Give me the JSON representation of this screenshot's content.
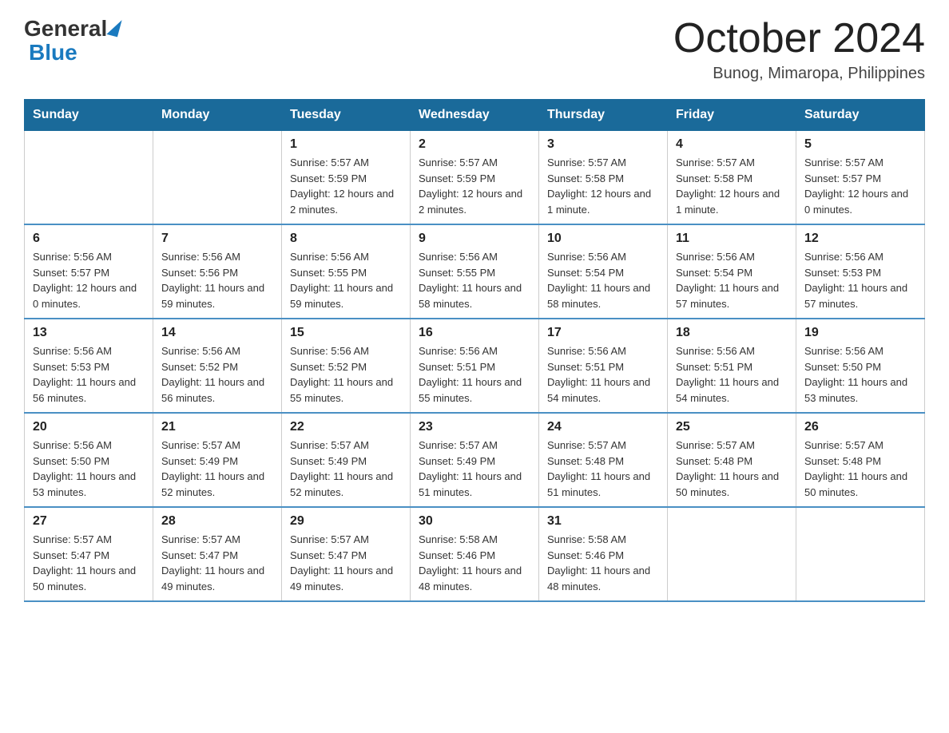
{
  "header": {
    "logo_general": "General",
    "logo_blue": "Blue",
    "month_title": "October 2024",
    "location": "Bunog, Mimaropa, Philippines"
  },
  "days_of_week": [
    "Sunday",
    "Monday",
    "Tuesday",
    "Wednesday",
    "Thursday",
    "Friday",
    "Saturday"
  ],
  "weeks": [
    [
      {
        "day": "",
        "sunrise": "",
        "sunset": "",
        "daylight": ""
      },
      {
        "day": "",
        "sunrise": "",
        "sunset": "",
        "daylight": ""
      },
      {
        "day": "1",
        "sunrise": "Sunrise: 5:57 AM",
        "sunset": "Sunset: 5:59 PM",
        "daylight": "Daylight: 12 hours and 2 minutes."
      },
      {
        "day": "2",
        "sunrise": "Sunrise: 5:57 AM",
        "sunset": "Sunset: 5:59 PM",
        "daylight": "Daylight: 12 hours and 2 minutes."
      },
      {
        "day": "3",
        "sunrise": "Sunrise: 5:57 AM",
        "sunset": "Sunset: 5:58 PM",
        "daylight": "Daylight: 12 hours and 1 minute."
      },
      {
        "day": "4",
        "sunrise": "Sunrise: 5:57 AM",
        "sunset": "Sunset: 5:58 PM",
        "daylight": "Daylight: 12 hours and 1 minute."
      },
      {
        "day": "5",
        "sunrise": "Sunrise: 5:57 AM",
        "sunset": "Sunset: 5:57 PM",
        "daylight": "Daylight: 12 hours and 0 minutes."
      }
    ],
    [
      {
        "day": "6",
        "sunrise": "Sunrise: 5:56 AM",
        "sunset": "Sunset: 5:57 PM",
        "daylight": "Daylight: 12 hours and 0 minutes."
      },
      {
        "day": "7",
        "sunrise": "Sunrise: 5:56 AM",
        "sunset": "Sunset: 5:56 PM",
        "daylight": "Daylight: 11 hours and 59 minutes."
      },
      {
        "day": "8",
        "sunrise": "Sunrise: 5:56 AM",
        "sunset": "Sunset: 5:55 PM",
        "daylight": "Daylight: 11 hours and 59 minutes."
      },
      {
        "day": "9",
        "sunrise": "Sunrise: 5:56 AM",
        "sunset": "Sunset: 5:55 PM",
        "daylight": "Daylight: 11 hours and 58 minutes."
      },
      {
        "day": "10",
        "sunrise": "Sunrise: 5:56 AM",
        "sunset": "Sunset: 5:54 PM",
        "daylight": "Daylight: 11 hours and 58 minutes."
      },
      {
        "day": "11",
        "sunrise": "Sunrise: 5:56 AM",
        "sunset": "Sunset: 5:54 PM",
        "daylight": "Daylight: 11 hours and 57 minutes."
      },
      {
        "day": "12",
        "sunrise": "Sunrise: 5:56 AM",
        "sunset": "Sunset: 5:53 PM",
        "daylight": "Daylight: 11 hours and 57 minutes."
      }
    ],
    [
      {
        "day": "13",
        "sunrise": "Sunrise: 5:56 AM",
        "sunset": "Sunset: 5:53 PM",
        "daylight": "Daylight: 11 hours and 56 minutes."
      },
      {
        "day": "14",
        "sunrise": "Sunrise: 5:56 AM",
        "sunset": "Sunset: 5:52 PM",
        "daylight": "Daylight: 11 hours and 56 minutes."
      },
      {
        "day": "15",
        "sunrise": "Sunrise: 5:56 AM",
        "sunset": "Sunset: 5:52 PM",
        "daylight": "Daylight: 11 hours and 55 minutes."
      },
      {
        "day": "16",
        "sunrise": "Sunrise: 5:56 AM",
        "sunset": "Sunset: 5:51 PM",
        "daylight": "Daylight: 11 hours and 55 minutes."
      },
      {
        "day": "17",
        "sunrise": "Sunrise: 5:56 AM",
        "sunset": "Sunset: 5:51 PM",
        "daylight": "Daylight: 11 hours and 54 minutes."
      },
      {
        "day": "18",
        "sunrise": "Sunrise: 5:56 AM",
        "sunset": "Sunset: 5:51 PM",
        "daylight": "Daylight: 11 hours and 54 minutes."
      },
      {
        "day": "19",
        "sunrise": "Sunrise: 5:56 AM",
        "sunset": "Sunset: 5:50 PM",
        "daylight": "Daylight: 11 hours and 53 minutes."
      }
    ],
    [
      {
        "day": "20",
        "sunrise": "Sunrise: 5:56 AM",
        "sunset": "Sunset: 5:50 PM",
        "daylight": "Daylight: 11 hours and 53 minutes."
      },
      {
        "day": "21",
        "sunrise": "Sunrise: 5:57 AM",
        "sunset": "Sunset: 5:49 PM",
        "daylight": "Daylight: 11 hours and 52 minutes."
      },
      {
        "day": "22",
        "sunrise": "Sunrise: 5:57 AM",
        "sunset": "Sunset: 5:49 PM",
        "daylight": "Daylight: 11 hours and 52 minutes."
      },
      {
        "day": "23",
        "sunrise": "Sunrise: 5:57 AM",
        "sunset": "Sunset: 5:49 PM",
        "daylight": "Daylight: 11 hours and 51 minutes."
      },
      {
        "day": "24",
        "sunrise": "Sunrise: 5:57 AM",
        "sunset": "Sunset: 5:48 PM",
        "daylight": "Daylight: 11 hours and 51 minutes."
      },
      {
        "day": "25",
        "sunrise": "Sunrise: 5:57 AM",
        "sunset": "Sunset: 5:48 PM",
        "daylight": "Daylight: 11 hours and 50 minutes."
      },
      {
        "day": "26",
        "sunrise": "Sunrise: 5:57 AM",
        "sunset": "Sunset: 5:48 PM",
        "daylight": "Daylight: 11 hours and 50 minutes."
      }
    ],
    [
      {
        "day": "27",
        "sunrise": "Sunrise: 5:57 AM",
        "sunset": "Sunset: 5:47 PM",
        "daylight": "Daylight: 11 hours and 50 minutes."
      },
      {
        "day": "28",
        "sunrise": "Sunrise: 5:57 AM",
        "sunset": "Sunset: 5:47 PM",
        "daylight": "Daylight: 11 hours and 49 minutes."
      },
      {
        "day": "29",
        "sunrise": "Sunrise: 5:57 AM",
        "sunset": "Sunset: 5:47 PM",
        "daylight": "Daylight: 11 hours and 49 minutes."
      },
      {
        "day": "30",
        "sunrise": "Sunrise: 5:58 AM",
        "sunset": "Sunset: 5:46 PM",
        "daylight": "Daylight: 11 hours and 48 minutes."
      },
      {
        "day": "31",
        "sunrise": "Sunrise: 5:58 AM",
        "sunset": "Sunset: 5:46 PM",
        "daylight": "Daylight: 11 hours and 48 minutes."
      },
      {
        "day": "",
        "sunrise": "",
        "sunset": "",
        "daylight": ""
      },
      {
        "day": "",
        "sunrise": "",
        "sunset": "",
        "daylight": ""
      }
    ]
  ]
}
